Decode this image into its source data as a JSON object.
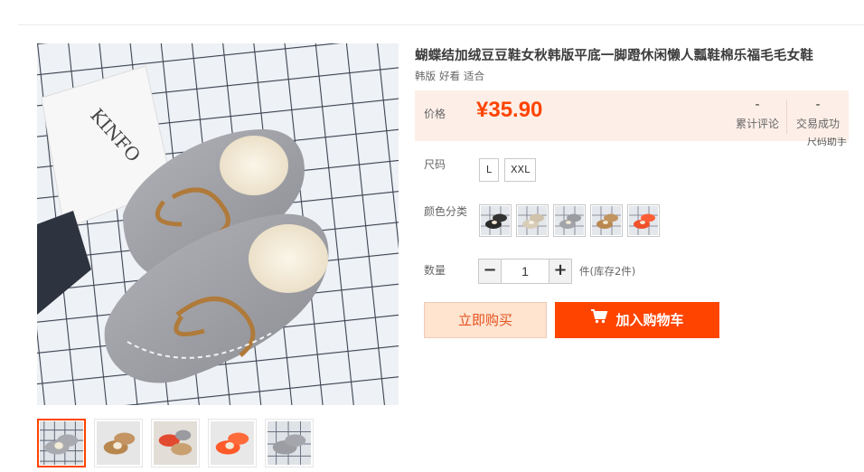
{
  "product": {
    "title": "蝴蝶结加绒豆豆鞋女秋韩版平底一脚蹬休闲懒人瓢鞋棉乐福毛毛女鞋",
    "tags": [
      "韩版",
      "好看",
      "适合"
    ]
  },
  "price": {
    "label": "价格",
    "value": "¥35.90",
    "reviews_count": "-",
    "reviews_label": "累计评论",
    "trades_count": "-",
    "trades_label": "交易成功",
    "size_help": "尺码助手"
  },
  "size": {
    "label": "尺码",
    "options": [
      "L",
      "XXL"
    ]
  },
  "color": {
    "label": "颜色分类",
    "options": [
      "black",
      "beige",
      "grey",
      "tan",
      "red"
    ]
  },
  "quantity": {
    "label": "数量",
    "minus": "−",
    "plus": "+",
    "value": "1",
    "stock": "件(库存2件)"
  },
  "actions": {
    "buy_now": "立即购买",
    "add_to_cart": "加入购物车",
    "cart_icon": "shopping-cart-icon"
  },
  "thumbnails": [
    {
      "color": "grey",
      "selected": true
    },
    {
      "color": "tan",
      "selected": false
    },
    {
      "color": "red",
      "selected": false
    },
    {
      "color": "orange",
      "selected": false
    },
    {
      "color": "grey",
      "selected": false
    }
  ],
  "colors": {
    "accent": "#ff4400",
    "price_bg": "#fdefe7",
    "buy_bg": "#ffe4d0"
  }
}
